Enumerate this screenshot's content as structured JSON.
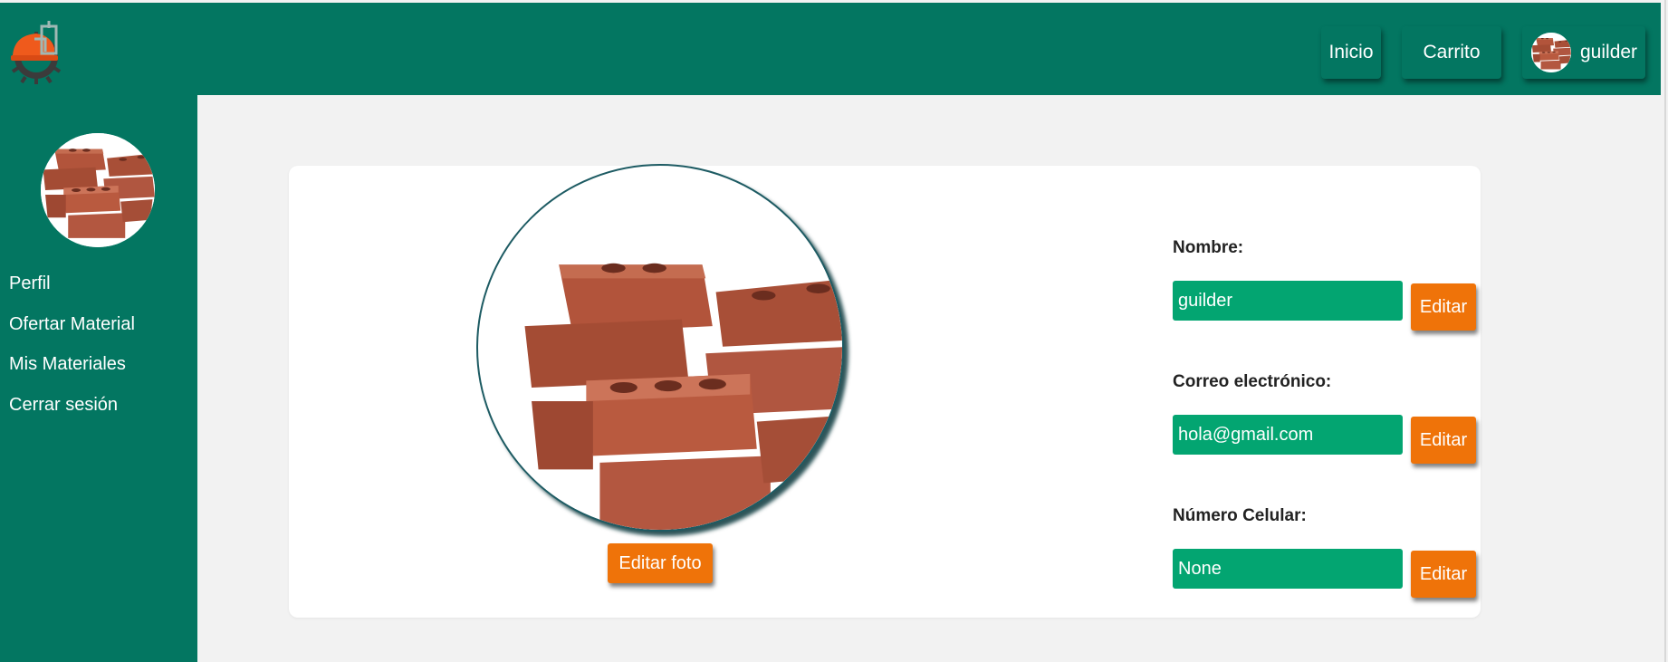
{
  "header": {
    "nav": {
      "inicio": "Inicio",
      "carrito": "Carrito",
      "username": "guilder"
    }
  },
  "sidebar": {
    "items": [
      {
        "label": "Perfil"
      },
      {
        "label": "Ofertar Material"
      },
      {
        "label": "Mis Materiales"
      },
      {
        "label": "Cerrar sesión"
      }
    ]
  },
  "profile": {
    "edit_photo_label": "Editar foto",
    "fields": [
      {
        "label": "Nombre:",
        "value": "guilder",
        "edit_label": "Editar"
      },
      {
        "label": "Correo electrónico:",
        "value": "hola@gmail.com",
        "edit_label": "Editar"
      },
      {
        "label": "Número Celular:",
        "value": "None",
        "edit_label": "Editar"
      }
    ]
  },
  "colors": {
    "primary": "#037661",
    "input": "#03a571",
    "accent": "#ef7309",
    "background": "#f2f2f2"
  },
  "icons": {
    "logo": "hardhat-gear-logo",
    "avatar": "bricks-avatar"
  }
}
